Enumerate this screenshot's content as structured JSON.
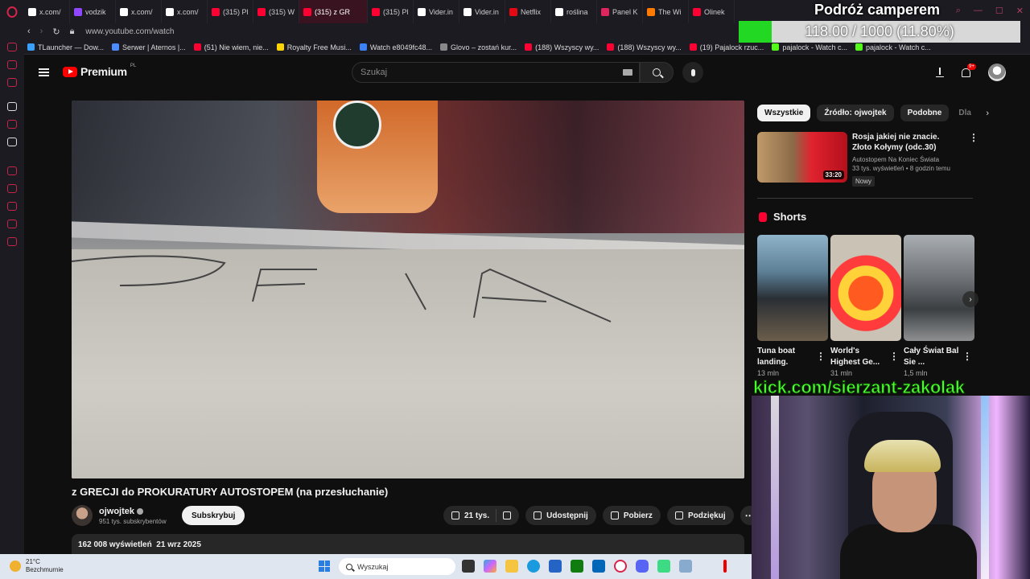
{
  "browser": {
    "tabs": [
      {
        "label": "x.com/",
        "icon": "x-icon",
        "color": "#ffffff"
      },
      {
        "label": "vodzik",
        "icon": "twitch-icon",
        "color": "#9147ff"
      },
      {
        "label": "x.com/",
        "icon": "x-icon",
        "color": "#ffffff"
      },
      {
        "label": "x.com/",
        "icon": "x-icon",
        "color": "#ffffff"
      },
      {
        "label": "(315) Pl",
        "icon": "youtube-icon",
        "color": "#ff0033"
      },
      {
        "label": "(315) W",
        "icon": "youtube-icon",
        "color": "#ff0033"
      },
      {
        "label": "(315) z GR",
        "icon": "youtube-icon",
        "color": "#ff0033",
        "active": true
      },
      {
        "label": "(315) Pl",
        "icon": "youtube-icon",
        "color": "#ff0033"
      },
      {
        "label": "Vider.in",
        "icon": "vider-icon",
        "color": "#ffffff"
      },
      {
        "label": "Vider.in",
        "icon": "vider-icon",
        "color": "#ffffff"
      },
      {
        "label": "Netflix",
        "icon": "netflix-icon",
        "color": "#e50914"
      },
      {
        "label": "roślina",
        "icon": "google-icon",
        "color": "#ffffff"
      },
      {
        "label": "Panel K",
        "icon": "panel-icon",
        "color": "#e0245e"
      },
      {
        "label": "The Wi",
        "icon": "flame-icon",
        "color": "#ff7a00"
      },
      {
        "label": "Olinek",
        "icon": "youtube-icon",
        "color": "#ff0033"
      }
    ],
    "url": "www.youtube.com/watch",
    "bookmarks": [
      {
        "label": "TLauncher — Dow...",
        "color": "#3aa0ff"
      },
      {
        "label": "Serwer | Aternos |...",
        "color": "#4b8cff"
      },
      {
        "label": "(51) Nie wiem, nie...",
        "color": "#ff0033"
      },
      {
        "label": "Royalty Free Musi...",
        "color": "#ffd400"
      },
      {
        "label": "Watch e8049fc48...",
        "color": "#3b82f6"
      },
      {
        "label": "Glovo – zostań kur...",
        "color": "#888888"
      },
      {
        "label": "(188) Wszyscy wy...",
        "color": "#ff0033"
      },
      {
        "label": "(188) Wszyscy wy...",
        "color": "#ff0033"
      },
      {
        "label": "(19) Pajalock rzuc...",
        "color": "#ff0033"
      },
      {
        "label": "pajalock - Watch c...",
        "color": "#53fc18"
      },
      {
        "label": "pajalock - Watch c...",
        "color": "#53fc18"
      }
    ]
  },
  "overlay": {
    "title": "Podróż camperem",
    "progress_text": "118.00 / 1000 (11.80%)",
    "progress_fraction": 0.118,
    "kick_text": "kick.com/sierzant-zakolak"
  },
  "youtube": {
    "logo_text": "Premium",
    "logo_region": "PL",
    "search_placeholder": "Szukaj",
    "notif_badge": "9+",
    "video": {
      "title": "z GRECJI do PROKURATURY AUTOSTOPEM (na przesłuchanie)",
      "channel": "ojwojtek",
      "subscribers": "951 tys. subskrybentów",
      "subscribe_label": "Subskrybuj",
      "likes": "21 tys.",
      "share_label": "Udostępnij",
      "download_label": "Pobierz",
      "thanks_label": "Podziękuj",
      "views": "162 008 wyświetleń",
      "date": "21 wrz 2025"
    },
    "chips": [
      "Wszystkie",
      "Źródło: ojwojtek",
      "Podobne",
      "Dla"
    ],
    "recommended": {
      "title": "Rosja jakiej nie znacie. Złoto Kołymy (odc.30)",
      "channel": "Autostopem Na Koniec Świata",
      "meta": "33 tys. wyświetleń • 8 godzin temu",
      "badge": "Nowy",
      "duration": "33:20"
    },
    "shorts_heading": "Shorts",
    "shorts": [
      {
        "title": "Tuna boat landing.",
        "views": "13 mln"
      },
      {
        "title": "World's Highest Ge...",
        "views": "31 mln"
      },
      {
        "title": "Cały Świat Bal Sie ...",
        "views": "1,5 mln"
      }
    ]
  },
  "taskbar": {
    "temp": "21°C",
    "weather": "Bezchmurnie",
    "search_placeholder": "Wyszukaj"
  },
  "colors": {
    "accent": "#ff0000",
    "progress_fill": "#22d822",
    "kick_green": "#4cff2e"
  }
}
